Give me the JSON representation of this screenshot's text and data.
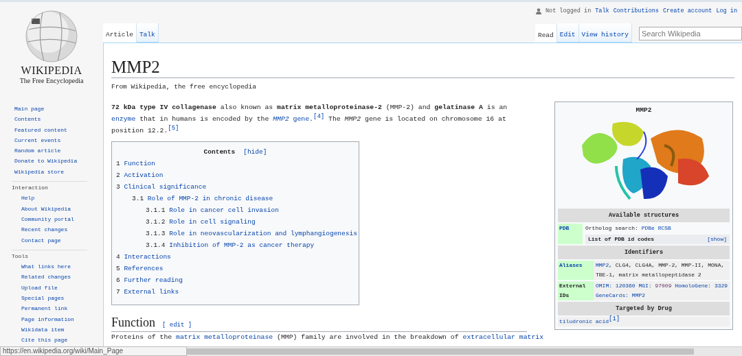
{
  "personal_tools": {
    "status": "Not logged in",
    "links": [
      "Talk",
      "Contributions",
      "Create account",
      "Log in"
    ]
  },
  "logo": {
    "wordmark": "WIKIPEDIA",
    "tagline": "The Free Encyclopedia"
  },
  "sidebar": {
    "navigation": [
      "Main page",
      "Contents",
      "Featured content",
      "Current events",
      "Random article",
      "Donate to Wikipedia",
      "Wikipedia store"
    ],
    "sections": [
      {
        "heading": "Interaction",
        "items": [
          "Help",
          "About Wikipedia",
          "Community portal",
          "Recent changes",
          "Contact page"
        ]
      },
      {
        "heading": "Tools",
        "items": [
          "What links here",
          "Related changes",
          "Upload file",
          "Special pages",
          "Permanent link",
          "Page information",
          "Wikidata item",
          "Cite this page"
        ]
      }
    ]
  },
  "namespace_tabs": [
    {
      "label": "Article",
      "selected": true
    },
    {
      "label": "Talk",
      "selected": false
    }
  ],
  "view_tabs": [
    {
      "label": "Read",
      "selected": true
    },
    {
      "label": "Edit",
      "selected": false
    },
    {
      "label": "View history",
      "selected": false
    }
  ],
  "search": {
    "placeholder": "Search Wikipedia"
  },
  "article": {
    "title": "MMP2",
    "tagline": "From Wikipedia, the free encyclopedia",
    "intro": [
      {
        "text": "72 kDa type IV collagenase",
        "kind": "bold"
      },
      {
        "text": " also known as ",
        "kind": "text"
      },
      {
        "text": "matrix metalloproteinase-2",
        "kind": "bold"
      },
      {
        "text": " (MMP-2) and ",
        "kind": "text"
      },
      {
        "text": "gelatinase A",
        "kind": "bold"
      },
      {
        "text": " is an ",
        "kind": "text"
      },
      {
        "text": "enzyme",
        "kind": "link"
      },
      {
        "text": " that in humans is encoded by the ",
        "kind": "text"
      },
      {
        "text": "MMP2",
        "kind": "italic_link"
      },
      {
        "text": " gene",
        "kind": "link"
      },
      {
        "text": ".",
        "kind": "text"
      },
      {
        "text": "[4]",
        "kind": "ref"
      },
      {
        "text": " The ",
        "kind": "text"
      },
      {
        "text": "MMP2",
        "kind": "italic"
      },
      {
        "text": " gene is located on chromosome 16 at position 12.2.",
        "kind": "text"
      },
      {
        "text": "[5]",
        "kind": "ref"
      }
    ],
    "toc": {
      "title": "Contents",
      "toggle": "[hide]",
      "items": [
        {
          "number": "1",
          "label": "Function"
        },
        {
          "number": "2",
          "label": "Activation"
        },
        {
          "number": "3",
          "label": "Clinical significance",
          "children": [
            {
              "number": "3.1",
              "label": "Role of MMP-2 in chronic disease",
              "children": [
                {
                  "number": "3.1.1",
                  "label": "Role in cancer cell invasion"
                },
                {
                  "number": "3.1.2",
                  "label": "Role in cell signaling"
                },
                {
                  "number": "3.1.3",
                  "label": "Role in neovascularization and lymphangiogenesis"
                },
                {
                  "number": "3.1.4",
                  "label": "Inhibition of MMP-2 as cancer therapy"
                }
              ]
            }
          ]
        },
        {
          "number": "4",
          "label": "Interactions"
        },
        {
          "number": "5",
          "label": "References"
        },
        {
          "number": "6",
          "label": "Further reading"
        },
        {
          "number": "7",
          "label": "External links"
        }
      ]
    },
    "section": {
      "heading": "Function",
      "edit": "[ edit ]",
      "paragraph": [
        {
          "text": "Proteins of the ",
          "kind": "text"
        },
        {
          "text": "matrix metalloproteinase",
          "kind": "link"
        },
        {
          "text": " (MMP) family are involved in the breakdown of ",
          "kind": "text"
        },
        {
          "text": "extracellular matrix",
          "kind": "link"
        }
      ]
    }
  },
  "infobox": {
    "title": "MMP2",
    "available_structures": {
      "heading": "Available structures",
      "label": "PDB",
      "ortholog_label": "Ortholog search:",
      "ortholog_links": [
        "PDBe",
        "RCSB"
      ],
      "list_title": "List of PDB id codes",
      "list_toggle": "[show]"
    },
    "identifiers": {
      "heading": "Identifiers",
      "rows": [
        {
          "label": "Aliases",
          "label_link": true,
          "parts": [
            {
              "text": "MMP2",
              "kind": "link"
            },
            {
              "text": ", CLG4, CLG4A, MMP-2, MMP-II, MONA, TBE-1, matrix metallopeptidase 2",
              "kind": "text"
            }
          ]
        },
        {
          "label": "External IDs",
          "label_link": false,
          "parts": [
            {
              "text": "OMIM:",
              "kind": "link"
            },
            {
              "text": "120360",
              "kind": "link"
            },
            {
              "text": "MGI:",
              "kind": "link"
            },
            {
              "text": "97009",
              "kind": "visited_link"
            },
            {
              "text": "HomoloGene:",
              "kind": "link"
            },
            {
              "text": "3329",
              "kind": "link"
            },
            {
              "text": "GeneCards:",
              "kind": "link"
            },
            {
              "text": "MMP2",
              "kind": "link"
            }
          ]
        }
      ]
    },
    "targeted_by_drug": {
      "heading": "Targeted by Drug",
      "parts": [
        {
          "text": "tiludronic acid",
          "kind": "link"
        },
        {
          "text": "[1]",
          "kind": "ref"
        }
      ]
    }
  },
  "status_url": "https://en.wikipedia.org/wiki/Main_Page"
}
